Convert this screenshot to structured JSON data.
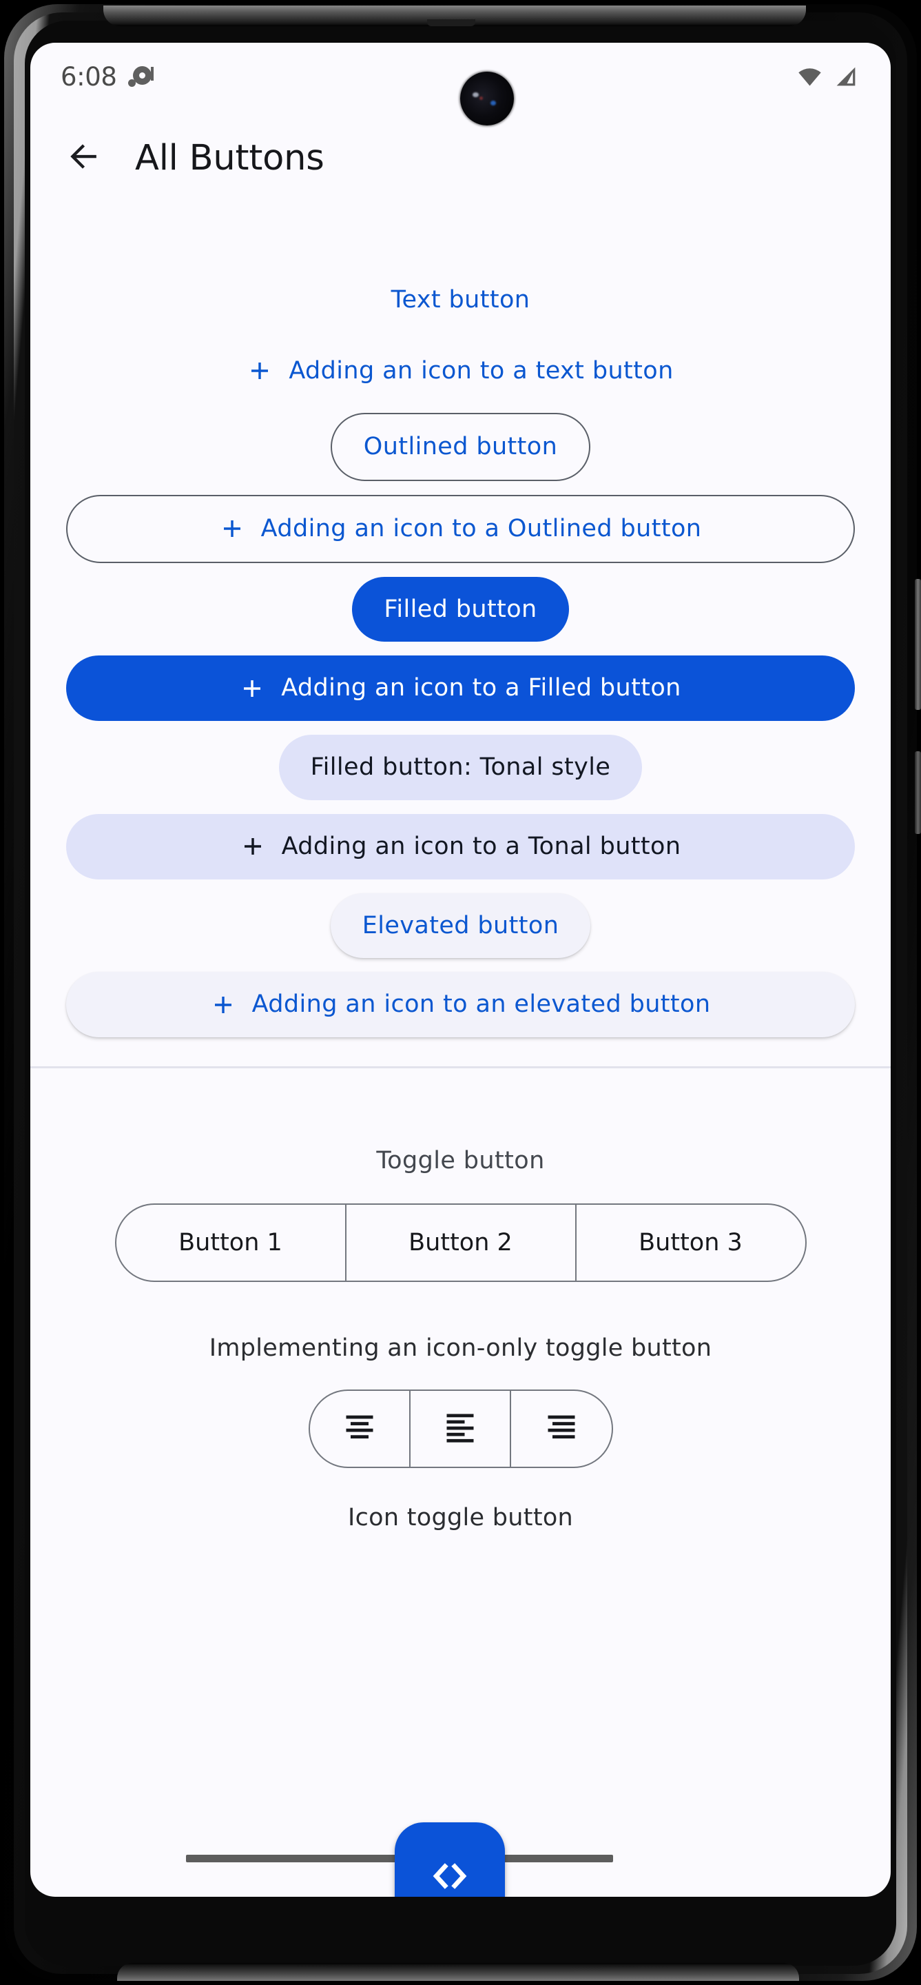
{
  "status_bar": {
    "clock": "6:08",
    "notification_icon": "notification-dot-icon",
    "wifi_icon": "wifi-icon",
    "signal_icon": "cellular-signal-icon"
  },
  "app_bar": {
    "back_icon": "back-arrow-icon",
    "title": "All Buttons"
  },
  "colors": {
    "primary": "#0b57d0",
    "filled_bg": "#0b53d8",
    "tonal_bg": "#dfe2f9",
    "elevated_bg": "#f2f2fa",
    "outline": "#5a5f68",
    "surface": "#FBFAFE",
    "on_tonal": "#121722",
    "divider": "#e2e2ec"
  },
  "buttons": {
    "text": {
      "label": "Text button"
    },
    "text_with_icon": {
      "label": "Adding an icon to a text button",
      "icon": "plus-icon"
    },
    "outlined": {
      "label": "Outlined button"
    },
    "outlined_with_icon": {
      "label": "Adding an icon to a Outlined button",
      "icon": "plus-icon"
    },
    "filled": {
      "label": "Filled button"
    },
    "filled_with_icon": {
      "label": "Adding an icon to a Filled button",
      "icon": "plus-icon"
    },
    "tonal": {
      "label": "Filled button: Tonal style"
    },
    "tonal_with_icon": {
      "label": "Adding an icon to a Tonal button",
      "icon": "plus-icon"
    },
    "elevated": {
      "label": "Elevated button"
    },
    "elevated_with_icon": {
      "label": "Adding an icon to an elevated button",
      "icon": "plus-icon"
    }
  },
  "toggle_section": {
    "title": "Toggle button",
    "segments": [
      {
        "label": "Button 1"
      },
      {
        "label": "Button 2"
      },
      {
        "label": "Button 3"
      }
    ]
  },
  "icon_toggle_section": {
    "title": "Implementing an icon-only toggle button",
    "segments": [
      {
        "icon": "format-align-center-icon"
      },
      {
        "icon": "format-align-left-icon"
      },
      {
        "icon": "format-align-right-icon"
      }
    ],
    "caption": "Icon toggle button"
  },
  "fab": {
    "icon": "code-brackets-icon"
  }
}
